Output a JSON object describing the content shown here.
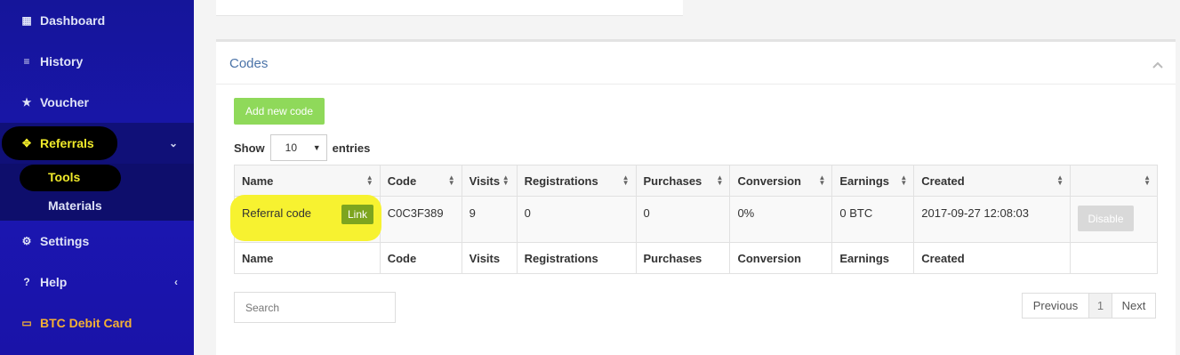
{
  "sidebar": {
    "items": [
      {
        "label": "Dashboard",
        "icon": "grid-icon"
      },
      {
        "label": "History",
        "icon": "list-icon"
      },
      {
        "label": "Voucher",
        "icon": "star-icon"
      },
      {
        "label": "Referrals",
        "icon": "arrows-icon"
      },
      {
        "label": "Settings",
        "icon": "gears-icon"
      },
      {
        "label": "Help",
        "icon": "question-icon"
      },
      {
        "label": "BTC Debit Card",
        "icon": "credit-card-icon"
      }
    ],
    "subitems": [
      {
        "label": "Tools"
      },
      {
        "label": "Materials"
      }
    ]
  },
  "panel": {
    "title": "Codes",
    "add_button": "Add new code",
    "show_label": "Show",
    "entries_label": "entries",
    "page_size": "10",
    "search_placeholder": "Search"
  },
  "table": {
    "headers": [
      "Name",
      "Code",
      "Visits",
      "Registrations",
      "Purchases",
      "Conversion",
      "Earnings",
      "Created",
      ""
    ],
    "rows": [
      {
        "name": "Referral code",
        "link": "Link",
        "code": "C0C3F389",
        "visits": "9",
        "registrations": "0",
        "purchases": "0",
        "conversion": "0%",
        "earnings": "0 BTC",
        "created": "2017-09-27 12:08:03",
        "action": "Disable"
      }
    ]
  },
  "pagination": {
    "previous": "Previous",
    "current": "1",
    "next": "Next"
  },
  "colors": {
    "accent_green": "#8fd95a",
    "highlight_yellow": "#f7f230",
    "sidebar_blue": "#1b16b0"
  }
}
